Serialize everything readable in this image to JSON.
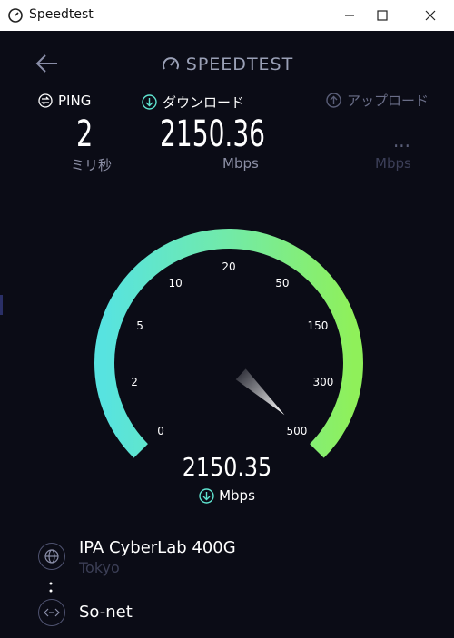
{
  "window": {
    "title": "Speedtest"
  },
  "header": {
    "title": "SPEEDTEST"
  },
  "ping": {
    "label": "PING",
    "value": "2",
    "unit": "ミリ秒"
  },
  "download": {
    "label": "ダウンロード",
    "value": "2150.36",
    "unit": "Mbps"
  },
  "upload": {
    "label": "アップロード",
    "value": "...",
    "unit": "Mbps"
  },
  "gauge": {
    "labels": [
      "0",
      "2",
      "5",
      "10",
      "20",
      "50",
      "150",
      "300",
      "500"
    ],
    "current_value": "2150.35",
    "unit": "Mbps",
    "needle_level": 1.0
  },
  "server": {
    "name": "IPA CyberLab 400G",
    "location": "Tokyo"
  },
  "isp": {
    "name": "So-net"
  },
  "colors": {
    "gauge_start": "#57e3e0",
    "gauge_end": "#8ff05a",
    "background": "#0b0c16"
  }
}
